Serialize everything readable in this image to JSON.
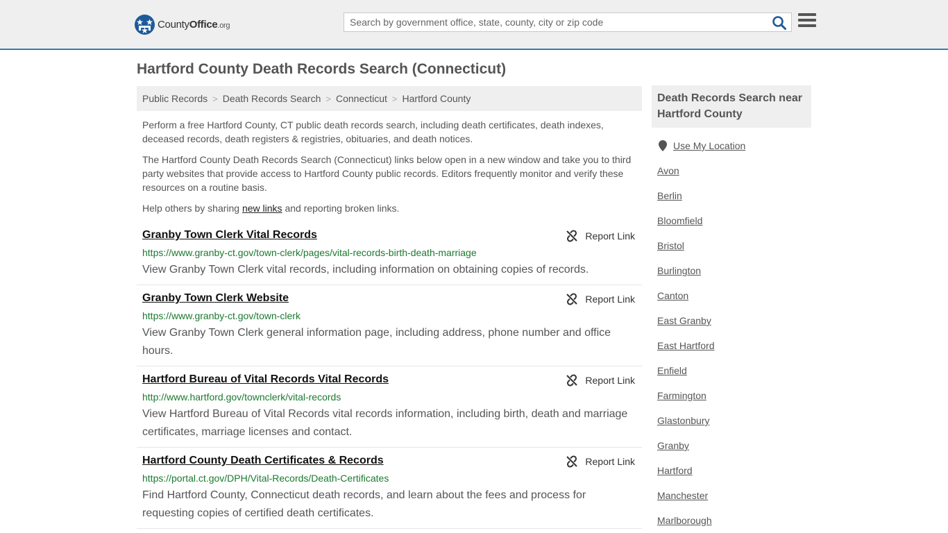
{
  "header": {
    "logo": {
      "brand_main": "County",
      "brand_bold": "Office",
      "brand_tld": ".org"
    },
    "search": {
      "placeholder": "Search by government office, state, county, city or zip code",
      "value": ""
    },
    "icons": {
      "search": "search-icon",
      "menu": "hamburger-menu-icon"
    }
  },
  "page": {
    "title": "Hartford County Death Records Search (Connecticut)",
    "breadcrumb": [
      "Public Records",
      "Death Records Search",
      "Connecticut",
      "Hartford County"
    ],
    "intro": [
      "Perform a free Hartford County, CT public death records search, including death certificates, death indexes, deceased records, death registers & registries, obituaries, and death notices.",
      "The Hartford County Death Records Search (Connecticut) links below open in a new window and take you to third party websites that provide access to Hartford County public records. Editors frequently monitor and verify these resources on a routine basis."
    ],
    "share": {
      "before": "Help others by sharing ",
      "link": "new links",
      "after": " and reporting broken links."
    }
  },
  "results": [
    {
      "title": "Granby Town Clerk Vital Records",
      "url": "https://www.granby-ct.gov/town-clerk/pages/vital-records-birth-death-marriage",
      "description": "View Granby Town Clerk vital records, including information on obtaining copies of records.",
      "report_label": "Report Link"
    },
    {
      "title": "Granby Town Clerk Website",
      "url": "https://www.granby-ct.gov/town-clerk",
      "description": "View Granby Town Clerk general information page, including address, phone number and office hours.",
      "report_label": "Report Link"
    },
    {
      "title": "Hartford Bureau of Vital Records Vital Records",
      "url": "http://www.hartford.gov/townclerk/vital-records",
      "description": "View Hartford Bureau of Vital Records vital records information, including birth, death and marriage certificates, marriage licenses and contact.",
      "report_label": "Report Link"
    },
    {
      "title": "Hartford County Death Certificates & Records",
      "url": "https://portal.ct.gov/DPH/Vital-Records/Death-Certificates",
      "description": "Find Hartford County, Connecticut death records, and learn about the fees and process for requesting copies of certified death certificates.",
      "report_label": "Report Link"
    }
  ],
  "sidebar": {
    "heading": "Death Records Search near Hartford County",
    "location_label": "Use My Location",
    "towns": [
      "Avon",
      "Berlin",
      "Bloomfield",
      "Bristol",
      "Burlington",
      "Canton",
      "East Granby",
      "East Hartford",
      "Enfield",
      "Farmington",
      "Glastonbury",
      "Granby",
      "Hartford",
      "Manchester",
      "Marlborough"
    ]
  },
  "colors": {
    "accent": "#3b78b4",
    "url_green": "#1a7a2e",
    "header_bg": "#efefef"
  }
}
